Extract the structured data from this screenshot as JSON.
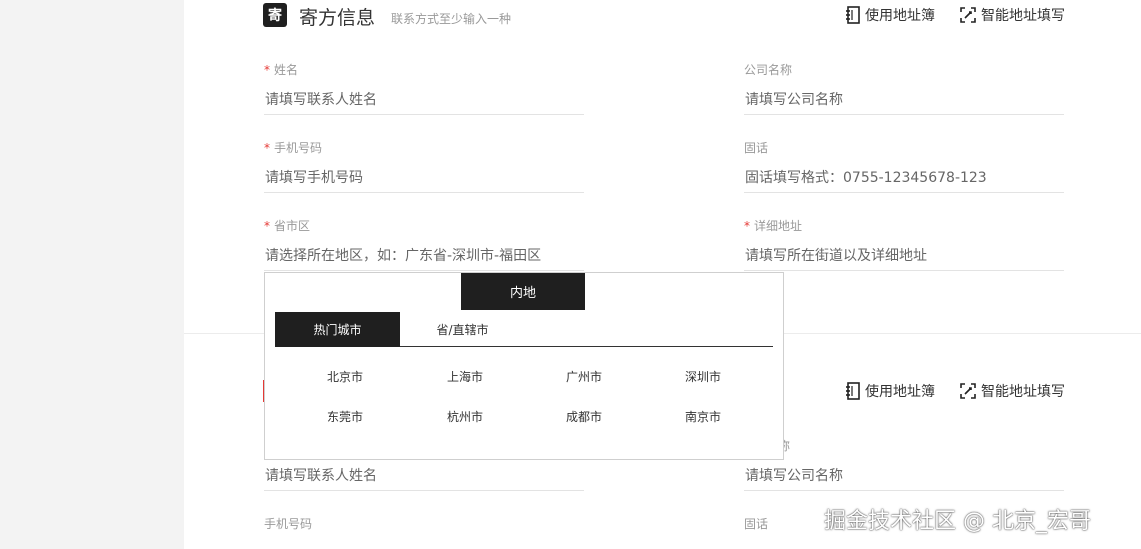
{
  "sender": {
    "badge": "寄",
    "title": "寄方信息",
    "hint": "联系方式至少输入一种",
    "address_book": "使用地址簿",
    "smart_fill": "智能地址填写",
    "name_label": "姓名",
    "name_placeholder": "请填写联系人姓名",
    "company_label": "公司名称",
    "company_placeholder": "请填写公司名称",
    "mobile_label": "手机号码",
    "mobile_placeholder": "请填写手机号码",
    "phone_label": "固话",
    "phone_placeholder": "固话填写格式：0755-12345678-123",
    "region_label": "省市区",
    "region_placeholder": "请选择所在地区，如：广东省-深圳市-福田区",
    "address_label": "详细地址",
    "address_placeholder": "请填写所在街道以及详细地址"
  },
  "receiver": {
    "address_book": "使用地址簿",
    "smart_fill": "智能地址填写",
    "company_label_partial": "称",
    "name_placeholder": "请填写联系人姓名",
    "company_placeholder": "请填写公司名称",
    "mobile_label": "手机号码",
    "phone_label": "固话"
  },
  "region_popup": {
    "main_tab": "内地",
    "tabs": [
      "热门城市",
      "省/直辖市"
    ],
    "cities": [
      "北京市",
      "上海市",
      "广州市",
      "深圳市",
      "东莞市",
      "杭州市",
      "成都市",
      "南京市"
    ]
  },
  "watermark": "掘金技术社区 @ 北京_宏哥"
}
